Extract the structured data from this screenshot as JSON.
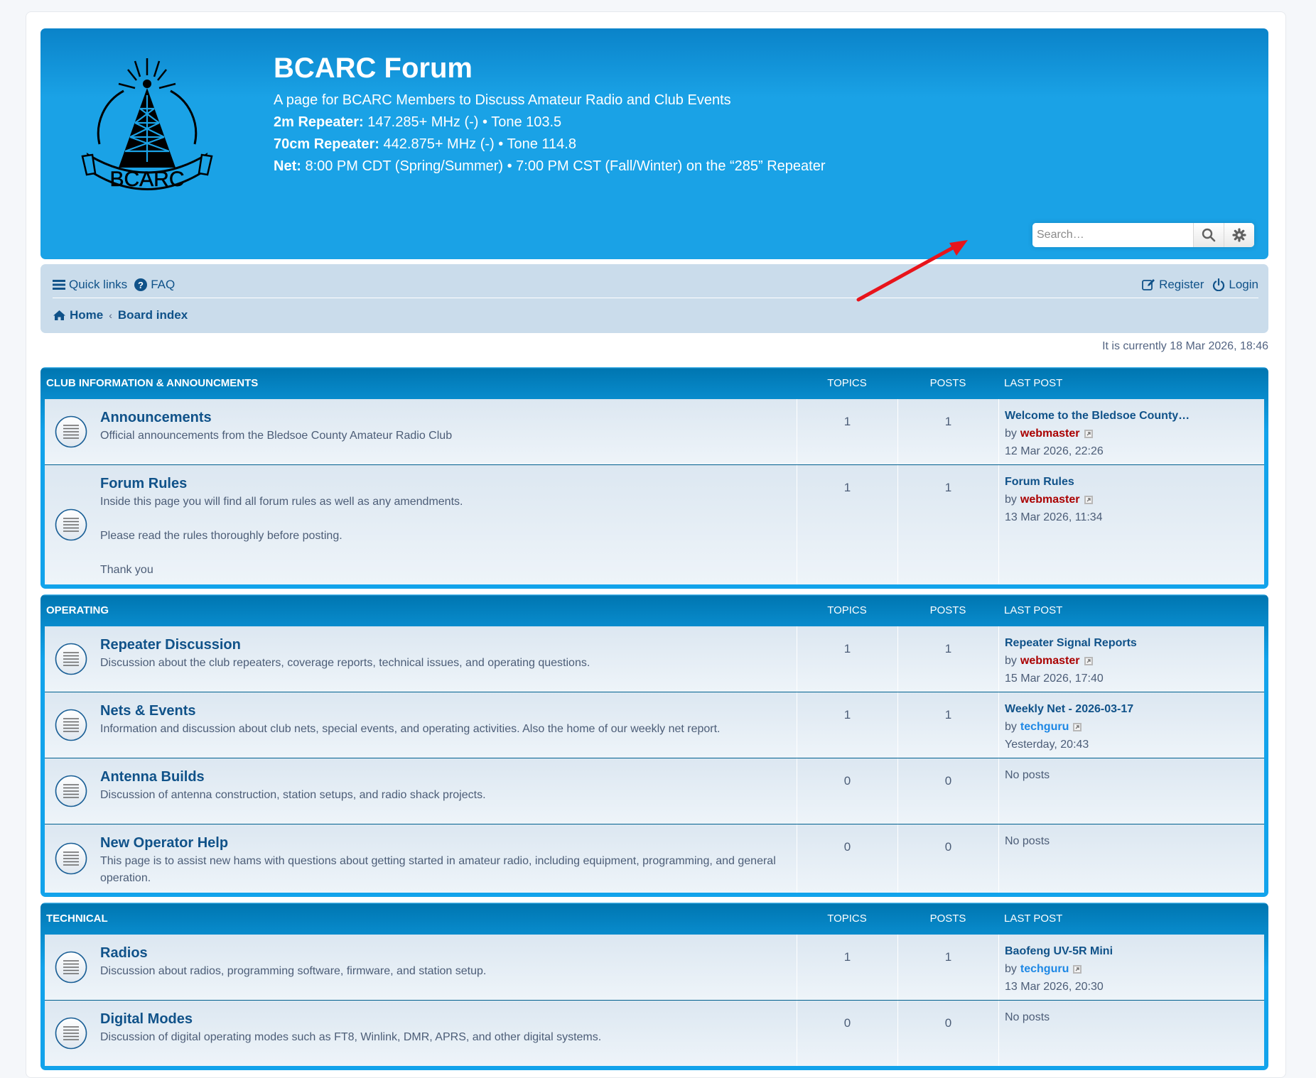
{
  "header": {
    "title": "BCARC Forum",
    "logo_text": "BCARC",
    "tagline": "A page for BCARC Members to Discuss Amateur Radio and Club Events",
    "rep2m_label": "2m Repeater:",
    "rep2m_value": " 147.285+ MHz (-) • Tone 103.5",
    "rep70_label": "70cm Repeater:",
    "rep70_value": " 442.875+ MHz (-) • Tone 114.8",
    "net_label": "Net:",
    "net_value": " 8:00 PM CDT (Spring/Summer) • 7:00 PM CST (Fall/Winter) on the “285” Repeater",
    "search_placeholder": "Search…"
  },
  "nav": {
    "quick_links": "Quick links",
    "faq": "FAQ",
    "register": "Register",
    "login": "Login",
    "home": "Home",
    "board_index": "Board index",
    "crumb_separator": "‹"
  },
  "current_time": "It is currently 18 Mar 2026, 18:46",
  "columns": {
    "topics": "TOPICS",
    "posts": "POSTS",
    "last_post": "LAST POST"
  },
  "colors": {
    "accent": "#12a3eb",
    "link": "#105289",
    "admin_user": "#aa0000",
    "user": "#1e88e5"
  },
  "categories": [
    {
      "name": "CLUB INFORMATION & ANNOUNCMENTS",
      "forums": [
        {
          "title": "Announcements",
          "desc": "Official announcements from the Bledsoe County Amateur Radio Club",
          "topics": "1",
          "posts": "1",
          "last_title": "Welcome to the Bledsoe County…",
          "by": "by",
          "user": "webmaster",
          "user_color": "#aa0000",
          "time": "12 Mar 2026, 22:26"
        },
        {
          "title": "Forum Rules",
          "desc": "Inside this page you will find all forum rules as well as any amendments.\n\nPlease read the rules thoroughly before posting.\n\nThank you",
          "topics": "1",
          "posts": "1",
          "last_title": "Forum Rules",
          "by": "by",
          "user": "webmaster",
          "user_color": "#aa0000",
          "time": "13 Mar 2026, 11:34"
        }
      ]
    },
    {
      "name": "OPERATING",
      "forums": [
        {
          "title": "Repeater Discussion",
          "desc": "Discussion about the club repeaters, coverage reports, technical issues, and operating questions.",
          "topics": "1",
          "posts": "1",
          "last_title": "Repeater Signal Reports",
          "by": "by",
          "user": "webmaster",
          "user_color": "#aa0000",
          "time": "15 Mar 2026, 17:40"
        },
        {
          "title": "Nets & Events",
          "desc": "Information and discussion about club nets, special events, and operating activities. Also the home of our weekly net report.",
          "topics": "1",
          "posts": "1",
          "last_title": "Weekly Net - 2026-03-17",
          "by": "by",
          "user": "techguru",
          "user_color": "#1e88e5",
          "time": "Yesterday, 20:43"
        },
        {
          "title": "Antenna Builds",
          "desc": "Discussion of antenna construction, station setups, and radio shack projects.",
          "topics": "0",
          "posts": "0",
          "no_posts": "No posts"
        },
        {
          "title": "New Operator Help",
          "desc": "This page is to assist new hams with questions about getting started in amateur radio, including equipment, programming, and general operation.",
          "topics": "0",
          "posts": "0",
          "no_posts": "No posts"
        }
      ]
    },
    {
      "name": "TECHNICAL",
      "forums": [
        {
          "title": "Radios",
          "desc": "Discussion about radios, programming software, firmware, and station setup.",
          "topics": "1",
          "posts": "1",
          "last_title": "Baofeng UV-5R Mini",
          "by": "by",
          "user": "techguru",
          "user_color": "#1e88e5",
          "time": "13 Mar 2026, 20:30"
        },
        {
          "title": "Digital Modes",
          "desc": "Discussion of digital operating modes such as FT8, Winlink, DMR, APRS, and other digital systems.",
          "topics": "0",
          "posts": "0",
          "no_posts": "No posts"
        }
      ]
    }
  ],
  "icons": {
    "forum": "forum-read-icon",
    "search": "search-icon",
    "advanced": "gear-icon",
    "register": "edit-icon",
    "login": "power-icon",
    "home": "home-icon",
    "faq": "question-icon",
    "quick_links": "menu-icon",
    "view_post": "view-post-icon"
  }
}
